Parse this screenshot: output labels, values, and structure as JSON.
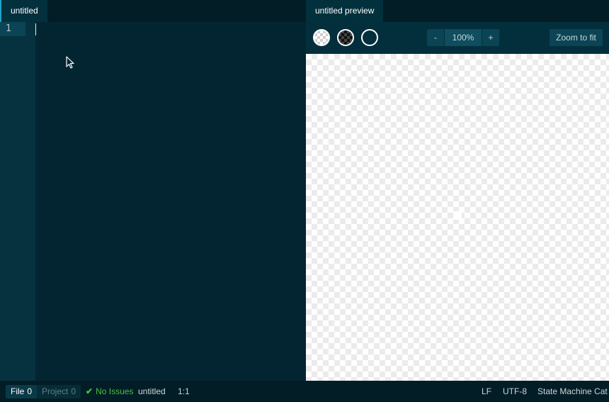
{
  "editor": {
    "tab_title": "untitled",
    "line_numbers": [
      "1"
    ]
  },
  "preview": {
    "tab_title": "untitled preview",
    "background_toggles": [
      {
        "name": "light-checkerboard",
        "selected": true
      },
      {
        "name": "dark-checkerboard",
        "selected": false
      },
      {
        "name": "transparent",
        "selected": false
      }
    ],
    "zoom_minus": "-",
    "zoom_level": "100%",
    "zoom_plus": "+",
    "zoom_to_fit": "Zoom to fit"
  },
  "status_bar": {
    "file_label": "File",
    "file_count": "0",
    "project_label": "Project",
    "project_count": "0",
    "issues_text": "No Issues",
    "file_name": "untitled",
    "cursor_position": "1:1",
    "line_ending": "LF",
    "encoding": "UTF-8",
    "grammar": "State Machine Cat"
  },
  "colors": {
    "editor_bg": "#032531",
    "gutter_bg": "#06323f",
    "active_line_number_bg": "#0a4455",
    "tab_accent": "#1fa4c7",
    "no_issues_green": "#47c245"
  },
  "icons": {
    "check": "check-icon",
    "pointer": "mouse-pointer-icon"
  }
}
